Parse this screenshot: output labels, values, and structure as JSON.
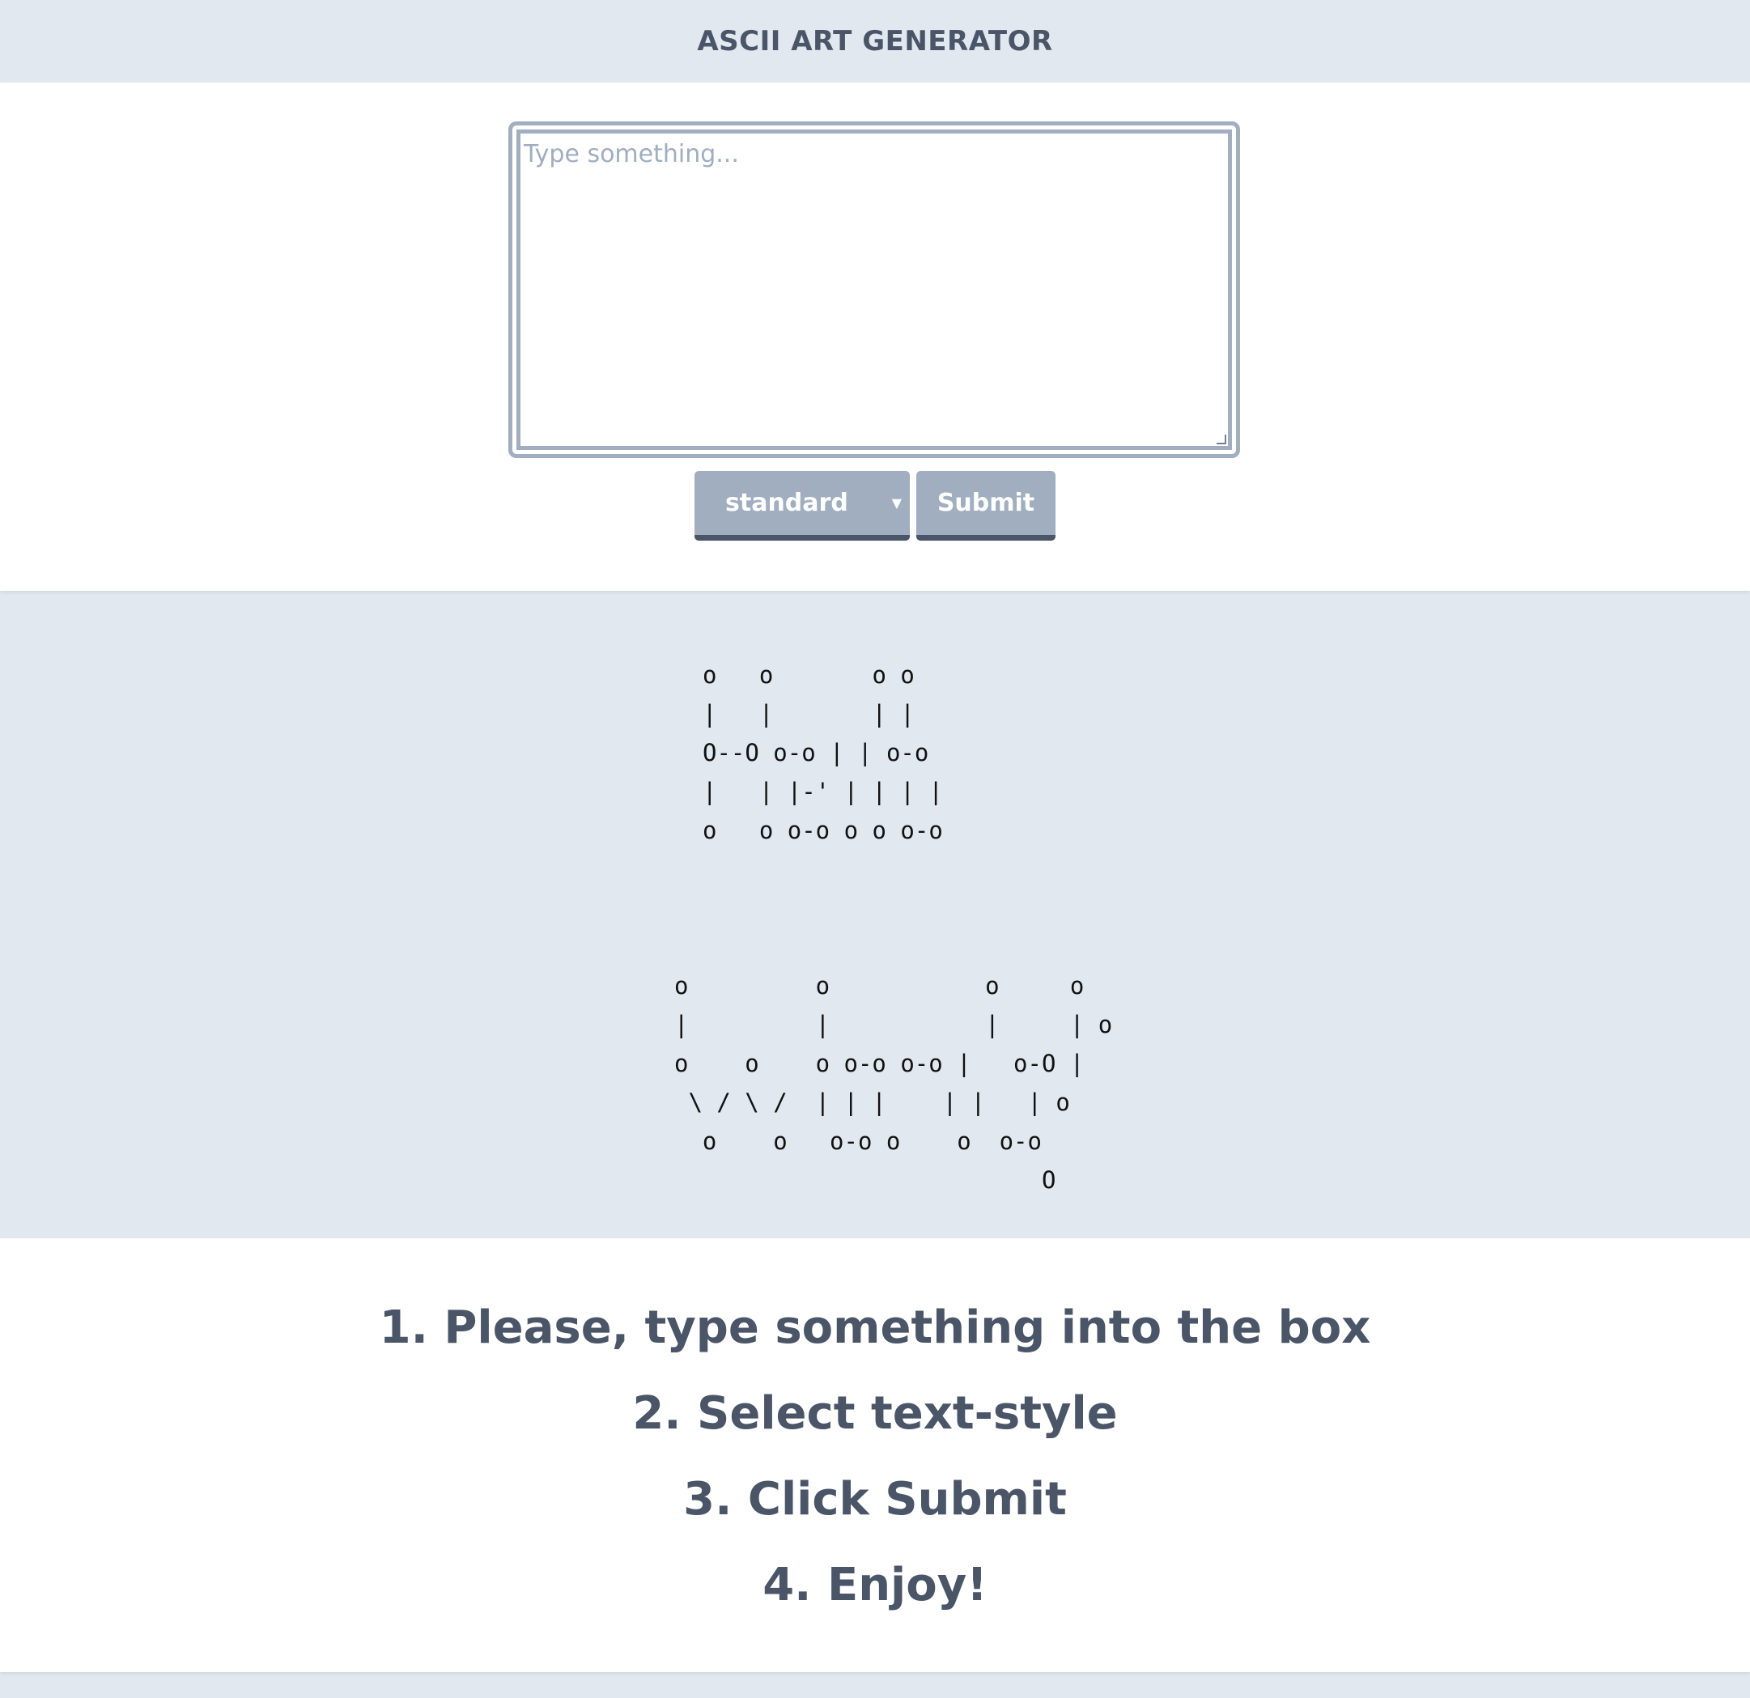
{
  "header": {
    "title": "ASCII ART GENERATOR"
  },
  "input": {
    "placeholder": "Type something...",
    "value": ""
  },
  "controls": {
    "style_select": {
      "selected": "standard",
      "icon": "chevron-down-icon"
    },
    "submit_label": "Submit"
  },
  "output": {
    "ascii_hello": "o   o       o o\n|   |       | |\nO--O o-o | | o-o\n|   | |-' | | | |\no   o o-o o o o-o",
    "ascii_world": "o         o           o     o\n|         |           |     | o\no    o    o o-o o-o |   o-O |\n \\ / \\ /  | | |    | |   | o\n  o    o   o-o o    o  o-o\n                          O"
  },
  "instructions": {
    "steps": [
      "1. Please, type something into the box",
      "2. Select text-style",
      "3. Click Submit",
      "4. Enjoy!"
    ]
  },
  "colors": {
    "page_background": "#e2e8f0",
    "card_background": "#ffffff",
    "accent_gray": "#a0aec0",
    "dark_slate": "#4a5568"
  }
}
